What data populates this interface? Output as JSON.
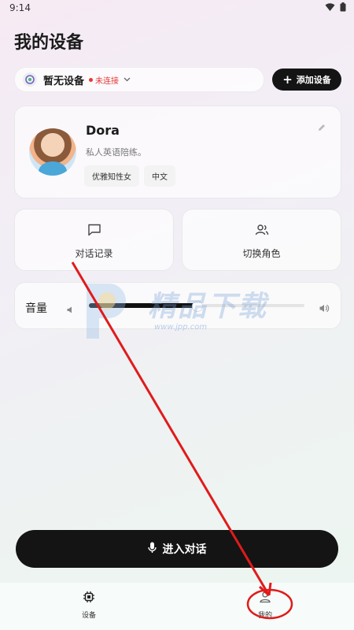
{
  "status_bar": {
    "time": "9:14"
  },
  "page_title": "我的设备",
  "device": {
    "name": "暂无设备",
    "status": "未连接"
  },
  "add_device_label": "添加设备",
  "profile": {
    "name": "Dora",
    "description": "私人英语陪练。",
    "tags": [
      "优雅知性女",
      "中文"
    ]
  },
  "actions": {
    "history_label": "对话记录",
    "switch_role_label": "切换角色"
  },
  "volume": {
    "label": "音量",
    "level": 0.5
  },
  "watermark": {
    "text": "精品下载",
    "url": "www.jpp.com"
  },
  "chat_button_label": "进入对话",
  "tabs": [
    {
      "label": "设备",
      "icon": "chip-icon"
    },
    {
      "label": "我的",
      "icon": "person-icon"
    }
  ],
  "colors": {
    "accent_dark": "#141414",
    "status_red": "#e53935",
    "annotation_red": "#e01b1b"
  }
}
